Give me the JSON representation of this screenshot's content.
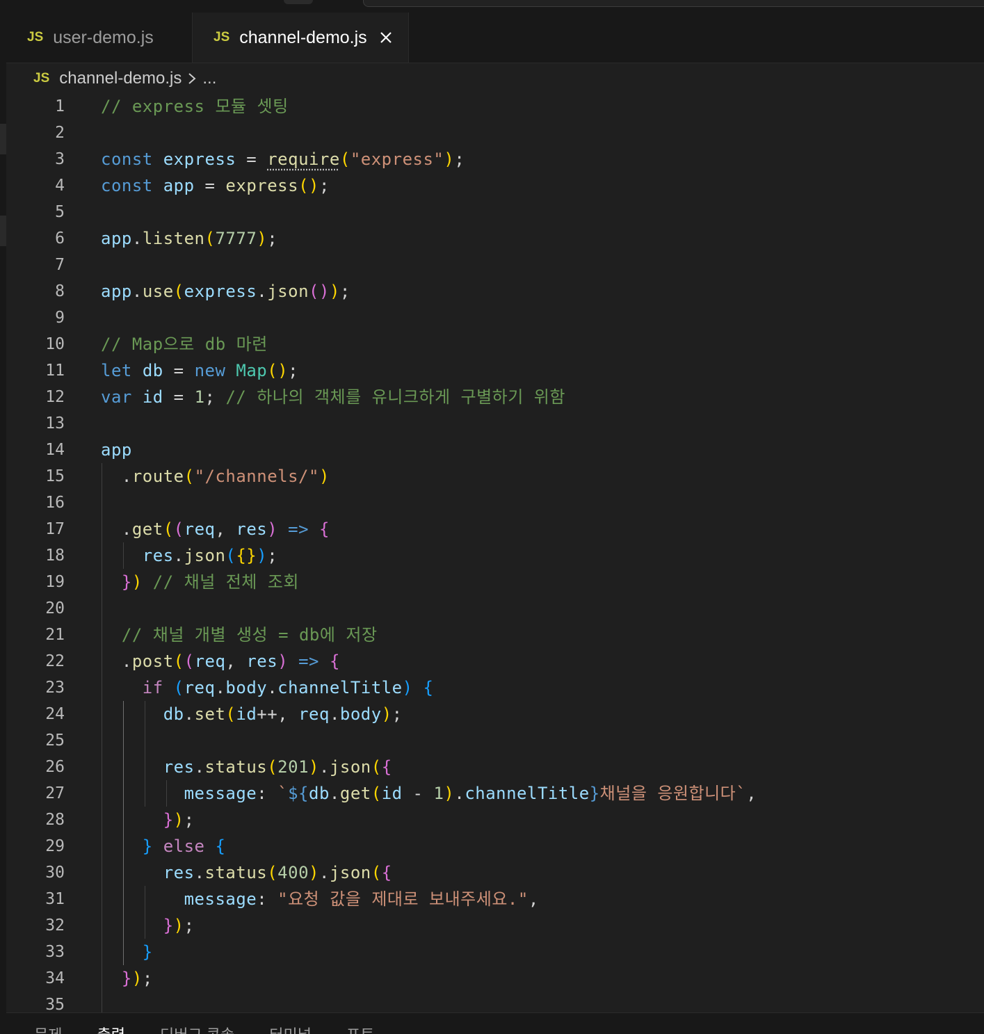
{
  "tabs": [
    {
      "label": "user-demo.js",
      "icon": "JS",
      "active": false
    },
    {
      "label": "channel-demo.js",
      "icon": "JS",
      "active": true
    }
  ],
  "breadcrumb": {
    "icon": "JS",
    "file": "channel-demo.js",
    "more": "..."
  },
  "lines": [
    "1",
    "2",
    "3",
    "4",
    "5",
    "6",
    "7",
    "8",
    "9",
    "10",
    "11",
    "12",
    "13",
    "14",
    "15",
    "16",
    "17",
    "18",
    "19",
    "20",
    "21",
    "22",
    "23",
    "24",
    "25",
    "26",
    "27",
    "28",
    "29",
    "30",
    "31",
    "32",
    "33",
    "34",
    "35"
  ],
  "code": {
    "l1": "// express 모듈 셋팅",
    "l10": "// Map으로 db 마련",
    "l12_cmt": "// 하나의 객체를 유니크하게 구별하기 위함",
    "l19_cmt": "// 채널 전체 조회",
    "l21": "// 채널 개별 생성 = db에 저장",
    "l27_tpl": "채널을 응원합니다`",
    "l31_str": "\"요청 값을 제대로 보내주세요.\""
  },
  "panel": {
    "tabs": [
      "문제",
      "출력",
      "디버그 콘솔",
      "터미널",
      "포트"
    ],
    "active": 1
  },
  "colors": {
    "keyword": "#569cd6",
    "comment": "#6a9955",
    "string": "#ce9178",
    "function": "#dcdcaa",
    "variable": "#9cdcfe"
  }
}
